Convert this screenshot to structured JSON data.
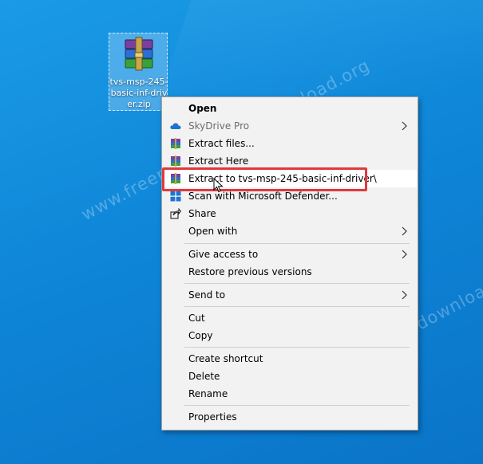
{
  "desktop": {
    "background_color": "#1590e0",
    "watermark_text": "www.freeprinterdriverdownload.org",
    "file": {
      "name": "tvs-msp-245-basic-inf-driver.zip",
      "icon": "winrar-archive-icon"
    }
  },
  "context_menu": {
    "items": {
      "open": {
        "label": "Open"
      },
      "skydrive_pro": {
        "label": "SkyDrive Pro",
        "icon": "cloud-icon"
      },
      "extract_files": {
        "label": "Extract files...",
        "icon": "winrar-icon"
      },
      "extract_here": {
        "label": "Extract Here",
        "icon": "winrar-icon"
      },
      "extract_to": {
        "label": "Extract to tvs-msp-245-basic-inf-driver\\",
        "icon": "winrar-icon"
      },
      "scan_defender": {
        "label": "Scan with Microsoft Defender...",
        "icon": "defender-shield-icon"
      },
      "share": {
        "label": "Share",
        "icon": "share-icon"
      },
      "open_with": {
        "label": "Open with"
      },
      "give_access": {
        "label": "Give access to"
      },
      "restore_versions": {
        "label": "Restore previous versions"
      },
      "send_to": {
        "label": "Send to"
      },
      "cut": {
        "label": "Cut"
      },
      "copy": {
        "label": "Copy"
      },
      "create_shortcut": {
        "label": "Create shortcut"
      },
      "delete": {
        "label": "Delete"
      },
      "rename": {
        "label": "Rename"
      },
      "properties": {
        "label": "Properties"
      }
    },
    "highlight_color": "#e0393e"
  }
}
